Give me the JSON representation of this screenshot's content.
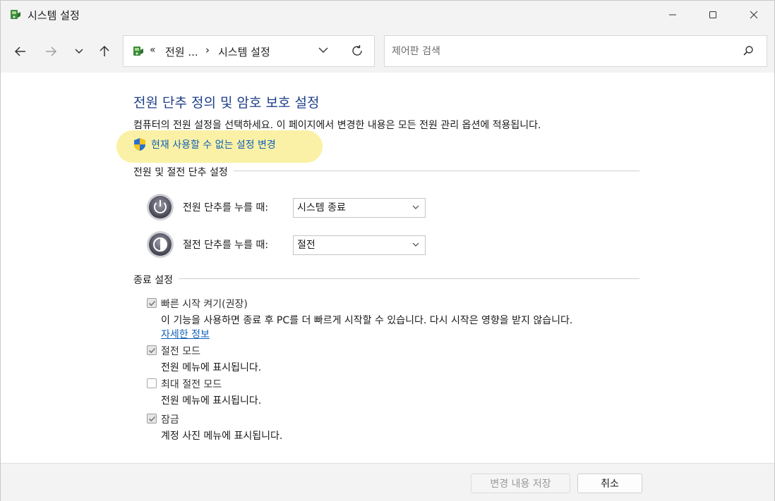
{
  "window": {
    "title": "시스템 설정"
  },
  "nav": {
    "crumb_prefix": "«",
    "crumb_parent": "전원 ...",
    "crumb_separator": "›",
    "crumb_current": "시스템 설정",
    "search_placeholder": "제어판 검색"
  },
  "main": {
    "title": "전원 단추 정의 및 암호 보호 설정",
    "description": "컴퓨터의 전원 설정을 선택하세요. 이 페이지에서 변경한 내용은 모든 전원 관리 옵션에 적용됩니다.",
    "uac_link": "현재 사용할 수 없는 설정 변경",
    "power_section": {
      "label": "전원 및 절전 단추 설정",
      "rows": [
        {
          "label": "전원 단추를 누를 때:",
          "value": "시스템 종료",
          "icon": "power-button-icon"
        },
        {
          "label": "절전 단추를 누를 때:",
          "value": "절전",
          "icon": "sleep-button-icon"
        }
      ]
    },
    "shutdown_section": {
      "label": "종료 설정",
      "items": [
        {
          "label": "빠른 시작 켜기(권장)",
          "checked": true,
          "disabled": true,
          "description": "이 기능을 사용하면 종료 후 PC를 더 빠르게 시작할 수 있습니다. 다시 시작은 영향을 받지 않습니다.",
          "link": "자세한 정보"
        },
        {
          "label": "절전 모드",
          "checked": true,
          "disabled": true,
          "description": "전원 메뉴에 표시됩니다."
        },
        {
          "label": "최대 절전 모드",
          "checked": false,
          "disabled": true,
          "description": "전원 메뉴에 표시됩니다."
        },
        {
          "label": "잠금",
          "checked": true,
          "disabled": true,
          "description": "계정 사진 메뉴에 표시됩니다."
        }
      ]
    }
  },
  "footer": {
    "save_label": "변경 내용 저장",
    "cancel_label": "취소"
  },
  "colors": {
    "title_blue": "#1e3f8a",
    "link_blue": "#1160b8",
    "highlight": "#fbf1a6",
    "chrome": "#f3f3f3"
  }
}
